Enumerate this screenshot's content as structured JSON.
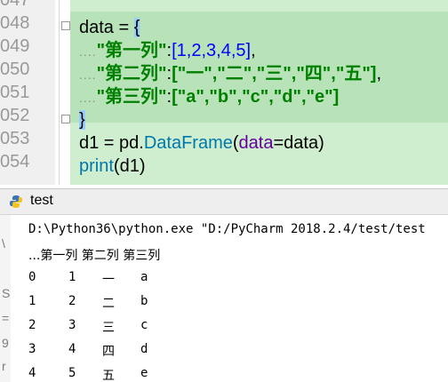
{
  "editor": {
    "line_numbers": [
      "047",
      "048",
      "049",
      "050",
      "051",
      "052",
      "053",
      "054"
    ],
    "lines": {
      "l48": {
        "name": "data",
        "assign": " = ",
        "open": "{"
      },
      "l49": {
        "indent": "....",
        "key": "\"第一列\"",
        "colon": ":",
        "value": "[1,2,3,4,5]",
        "tail": ","
      },
      "l50": {
        "indent": "....",
        "key": "\"第二列\"",
        "colon": ":",
        "value": "[\"一\",\"二\",\"三\",\"四\",\"五\"]",
        "tail": ","
      },
      "l51": {
        "indent": "....",
        "key": "\"第三列\"",
        "colon": ":",
        "value": "[\"a\",\"b\",\"c\",\"d\",\"e\"]"
      },
      "l52": {
        "close": "}"
      },
      "l53": {
        "lhs": "d1 = pd.",
        "call": "DataFrame",
        "open": "(",
        "kwarg": "data",
        "eq": "=",
        "arg": "data",
        "close": ")"
      },
      "l54": {
        "fn": "print",
        "args": "(d1)"
      }
    }
  },
  "run_panel": {
    "tab_label": "test",
    "command": "D:\\Python36\\python.exe \"D:/PyCharm 2018.2.4/test/test",
    "header_line": "...第一列 第二列 第三列",
    "gutter_marks": [
      "\\",
      "S",
      "=",
      "9",
      "r"
    ],
    "rows": [
      [
        "0",
        "1",
        "一",
        "a"
      ],
      [
        "1",
        "2",
        "二",
        "b"
      ],
      [
        "2",
        "3",
        "三",
        "c"
      ],
      [
        "3",
        "4",
        "四",
        "d"
      ],
      [
        "4",
        "5",
        "五",
        "e"
      ]
    ]
  }
}
